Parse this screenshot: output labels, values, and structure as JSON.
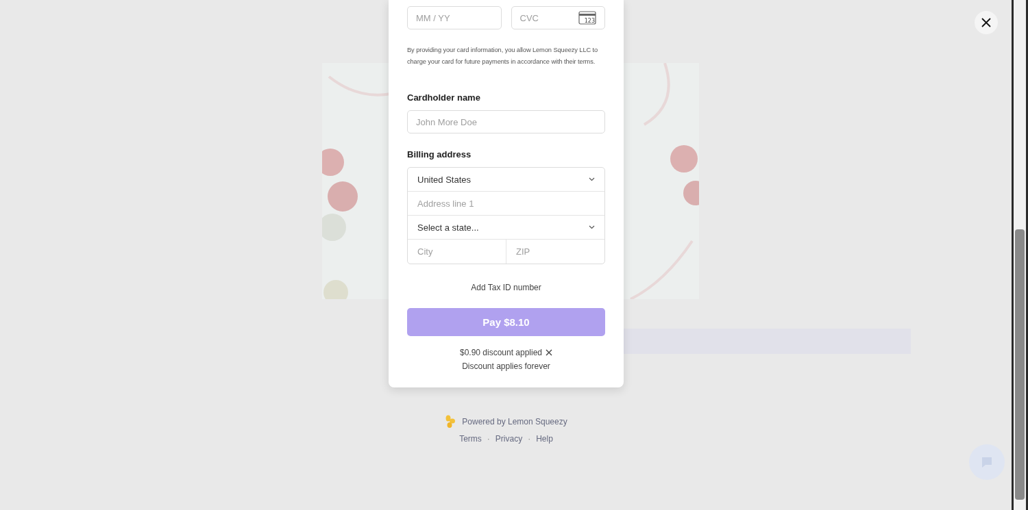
{
  "checkout": {
    "card_fields": [
      {
        "placeholder": "MM / YY",
        "kind": "expiry"
      },
      {
        "placeholder": "CVC",
        "kind": "cvc",
        "icon_text": "123"
      }
    ],
    "consent": "By providing your card information, you allow Lemon Squeezy LLC to charge your card for future payments in accordance with their terms.",
    "cardholder": {
      "label": "Cardholder name",
      "placeholder": "John More Doe"
    },
    "billing": {
      "label": "Billing address",
      "country": "United States",
      "address_placeholder": "Address line 1",
      "state_placeholder": "Select a state...",
      "city_placeholder": "City",
      "zip_placeholder": "ZIP"
    },
    "tax_link": "Add Tax ID number",
    "pay_button": "Pay $8.10",
    "discount": "$0.90 discount applied",
    "discount_note": "Discount applies forever"
  },
  "footer": {
    "powered_by": "Powered by Lemon Squeezy",
    "links": [
      "Terms",
      "Privacy",
      "Help"
    ],
    "separator": "·"
  }
}
